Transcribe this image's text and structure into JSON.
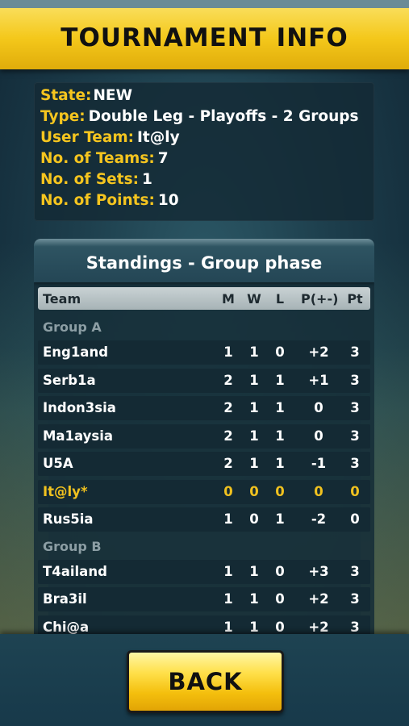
{
  "title": "TOURNAMENT INFO",
  "info": [
    {
      "key": "State:",
      "value": "NEW"
    },
    {
      "key": "Type:",
      "value": "Double Leg - Playoffs - 2 Groups"
    },
    {
      "key": "User Team:",
      "value": "It@ly"
    },
    {
      "key": "No. of Teams:",
      "value": "7"
    },
    {
      "key": "No. of Sets:",
      "value": "1"
    },
    {
      "key": "No. of Points:",
      "value": "10"
    }
  ],
  "standings": {
    "title": "Standings - Group phase",
    "columns": {
      "team": "Team",
      "m": "M",
      "w": "W",
      "l": "L",
      "p": "P(+-)",
      "pt": "Pt"
    },
    "groups": [
      {
        "label": "Group A",
        "rows": [
          {
            "team": "Eng1and",
            "m": "1",
            "w": "1",
            "l": "0",
            "p": "+2",
            "pt": "3"
          },
          {
            "team": "Serb1a",
            "m": "2",
            "w": "1",
            "l": "1",
            "p": "+1",
            "pt": "3"
          },
          {
            "team": "Indon3sia",
            "m": "2",
            "w": "1",
            "l": "1",
            "p": "0",
            "pt": "3"
          },
          {
            "team": "Ma1aysia",
            "m": "2",
            "w": "1",
            "l": "1",
            "p": "0",
            "pt": "3"
          },
          {
            "team": "U5A",
            "m": "2",
            "w": "1",
            "l": "1",
            "p": "-1",
            "pt": "3"
          },
          {
            "team": "It@ly*",
            "m": "0",
            "w": "0",
            "l": "0",
            "p": "0",
            "pt": "0",
            "user": true
          },
          {
            "team": "Rus5ia",
            "m": "1",
            "w": "0",
            "l": "1",
            "p": "-2",
            "pt": "0"
          }
        ]
      },
      {
        "label": "Group B",
        "rows": [
          {
            "team": "T4ailand",
            "m": "1",
            "w": "1",
            "l": "0",
            "p": "+3",
            "pt": "3"
          },
          {
            "team": "Bra3il",
            "m": "1",
            "w": "1",
            "l": "0",
            "p": "+2",
            "pt": "3"
          },
          {
            "team": "Chi@a",
            "m": "1",
            "w": "1",
            "l": "0",
            "p": "+2",
            "pt": "3"
          }
        ]
      }
    ]
  },
  "back_button": "BACK",
  "colors": {
    "accent": "#f5c51f",
    "panel": "#142a34",
    "user_team": "#f1c21f"
  }
}
